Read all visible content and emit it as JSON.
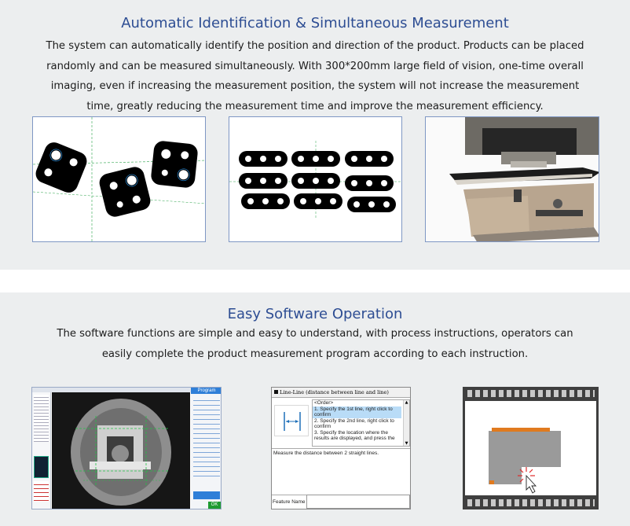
{
  "section1": {
    "title": "Automatic Identification & Simultaneous Measurement",
    "paragraph": "The system can automatically identify the position and direction of the product. Products can be placed randomly and can be measured simultaneously. With 300*200mm large field of vision, one-time overall imaging, even if increasing the measurement position, the system will not increase the measurement time, greatly reducing the measurement time and improve the measurement efficiency."
  },
  "section2": {
    "title": "Easy Software Operation",
    "paragraph": "The software functions are simple and easy to understand, with process instructions, operators can easily complete the product measurement program according to each instruction."
  },
  "software_screen": {
    "tab_label": "Program",
    "ok_label": "OK"
  },
  "line_dialog": {
    "header": "Line-Line (distance between line and line)",
    "order_label": "<Order>",
    "steps": [
      "1. Specify the 1st line, right click to confirm",
      "2. Specify the 2nd line, right click to confirm",
      "3. Specify the location where the results are displayed, and press the"
    ],
    "description": "Measure the distance between 2 straight lines.",
    "feature_name_label": "Feature Name"
  },
  "colors": {
    "title": "#2d4d93",
    "frame_border": "#7f97c4",
    "section_bg": "#eceeef",
    "accent_orange": "#e07a1f",
    "selection_blue": "#b9dcf7"
  }
}
